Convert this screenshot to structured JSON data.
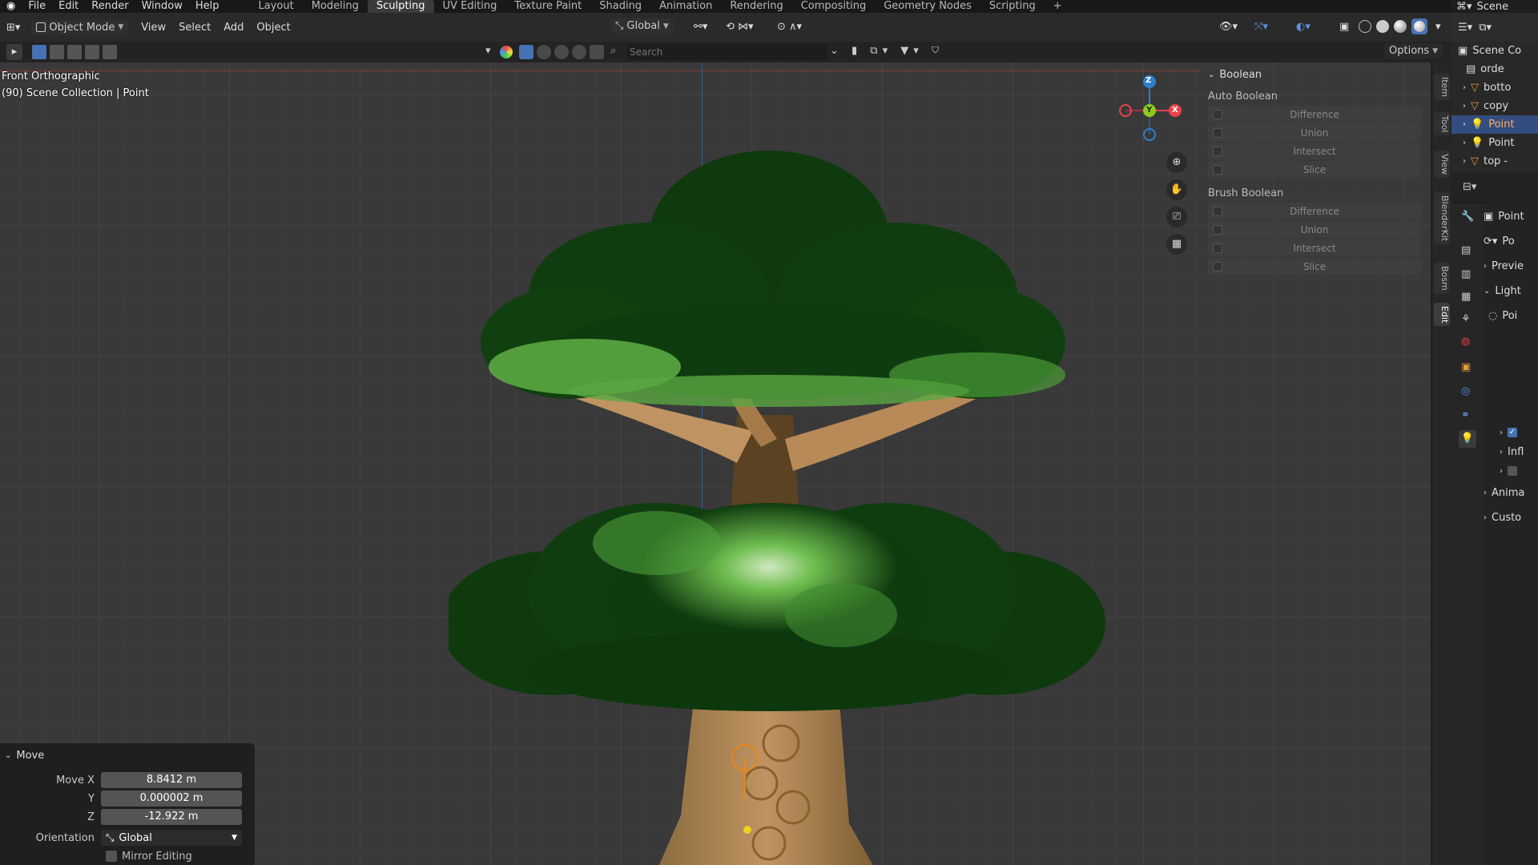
{
  "menu": {
    "items": [
      "File",
      "Edit",
      "Render",
      "Window",
      "Help"
    ]
  },
  "workspaces": [
    "Layout",
    "Modeling",
    "Sculpting",
    "UV Editing",
    "Texture Paint",
    "Shading",
    "Animation",
    "Rendering",
    "Compositing",
    "Geometry Nodes",
    "Scripting"
  ],
  "active_workspace": "Sculpting",
  "add_workspace": "+",
  "scene_label": "Scene",
  "header": {
    "mode": "Object Mode",
    "view": "View",
    "select": "Select",
    "add": "Add",
    "object": "Object",
    "orientation": "Global",
    "options": "Options",
    "search_placeholder": "Search"
  },
  "viewport": {
    "view_name": "Front Orthographic",
    "collection_line": "(90) Scene Collection | Point",
    "gizmo": {
      "z": "Z",
      "y": "Y",
      "x": "X"
    }
  },
  "boolean_panel": {
    "title": "Boolean",
    "auto_title": "Auto Boolean",
    "auto_ops": [
      "Difference",
      "Union",
      "Intersect",
      "Slice"
    ],
    "brush_title": "Brush Boolean",
    "brush_ops": [
      "Difference",
      "Union",
      "Intersect",
      "Slice"
    ]
  },
  "side_tabs": [
    "Item",
    "Tool",
    "View",
    "BlenderKit",
    "Bosm",
    "Edit"
  ],
  "outliner": {
    "root": "Scene Co",
    "rows": [
      "orde",
      "botto",
      "copy",
      "Point",
      "Point",
      "top -"
    ]
  },
  "properties": {
    "object_name": "Point",
    "data_name": "Po",
    "sections": [
      "Previe",
      "Light",
      "Poi",
      "Infl",
      "Anima",
      "Custo"
    ]
  },
  "move_panel": {
    "title": "Move",
    "fields": [
      {
        "label": "Move X",
        "value": "8.8412 m"
      },
      {
        "label": "Y",
        "value": "0.000002 m"
      },
      {
        "label": "Z",
        "value": "-12.922 m"
      }
    ],
    "orientation_label": "Orientation",
    "orientation_value": "Global",
    "mirror_label": "Mirror Editing"
  },
  "colors": {
    "accent": "#4772b3",
    "axis_x": "#e8434b",
    "axis_y": "#8dcb1e",
    "axis_z": "#2f7fd0",
    "canopy_dark": "#0e3a0e",
    "canopy_light": "#6fbd4f",
    "trunk": "#b0895a"
  }
}
